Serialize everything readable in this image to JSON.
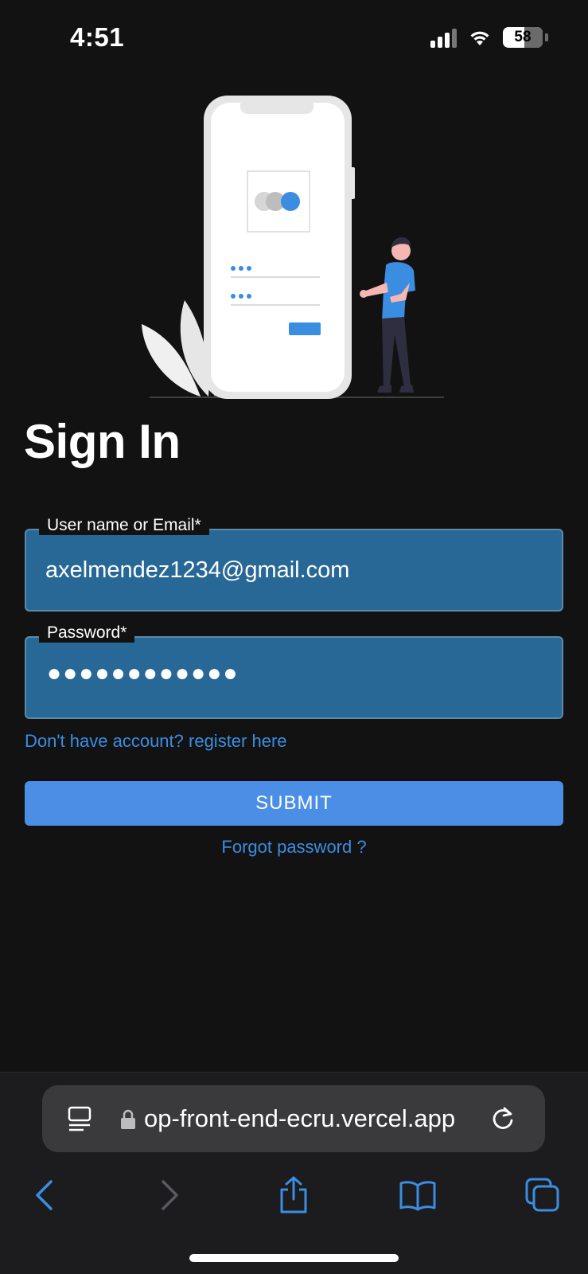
{
  "status_bar": {
    "time": "4:51",
    "battery": "58"
  },
  "page": {
    "title": "Sign In"
  },
  "form": {
    "email_label": "User name or Email*",
    "email_value": "axelmendez1234@gmail.com",
    "password_label": "Password*",
    "password_mask": "●●●●●●●●●●●●",
    "register_link": "Don't have account? register here",
    "submit_label": "SUBMIT",
    "forgot_link": "Forgot password ?"
  },
  "browser": {
    "url": "op-front-end-ecru.vercel.app"
  },
  "colors": {
    "background": "#121212",
    "field_bg": "#286897",
    "accent": "#4a8fe5",
    "link": "#3b8de2"
  }
}
